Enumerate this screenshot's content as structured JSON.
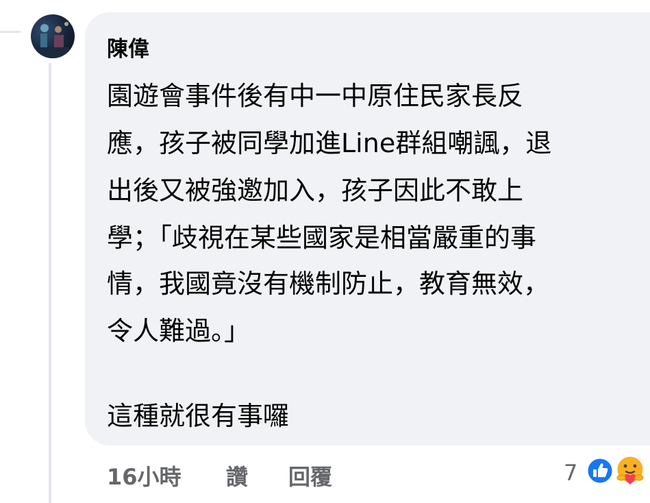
{
  "comment": {
    "author": "陳偉",
    "lines": [
      "園遊會事件後有中一中原住民家長反",
      "應，孩子被同學加進Line群組嘲諷，退",
      "出後又被強邀加入，孩子因此不敢上",
      "學；「歧視在某些國家是相當嚴重的事",
      "情，我國竟沒有機制防止，教育無效，",
      "令人難過。」",
      "這種就很有事囉"
    ]
  },
  "actions": {
    "time": "16小時",
    "like_label": "讚",
    "reply_label": "回覆"
  },
  "reactions": {
    "count": "7",
    "icons": [
      "like-icon",
      "care-icon"
    ],
    "like_color": "#1877f2",
    "care_color": "#f7b125"
  },
  "colors": {
    "bubble": "#f0f2f5",
    "text": "#050505",
    "secondary": "#65676b"
  }
}
